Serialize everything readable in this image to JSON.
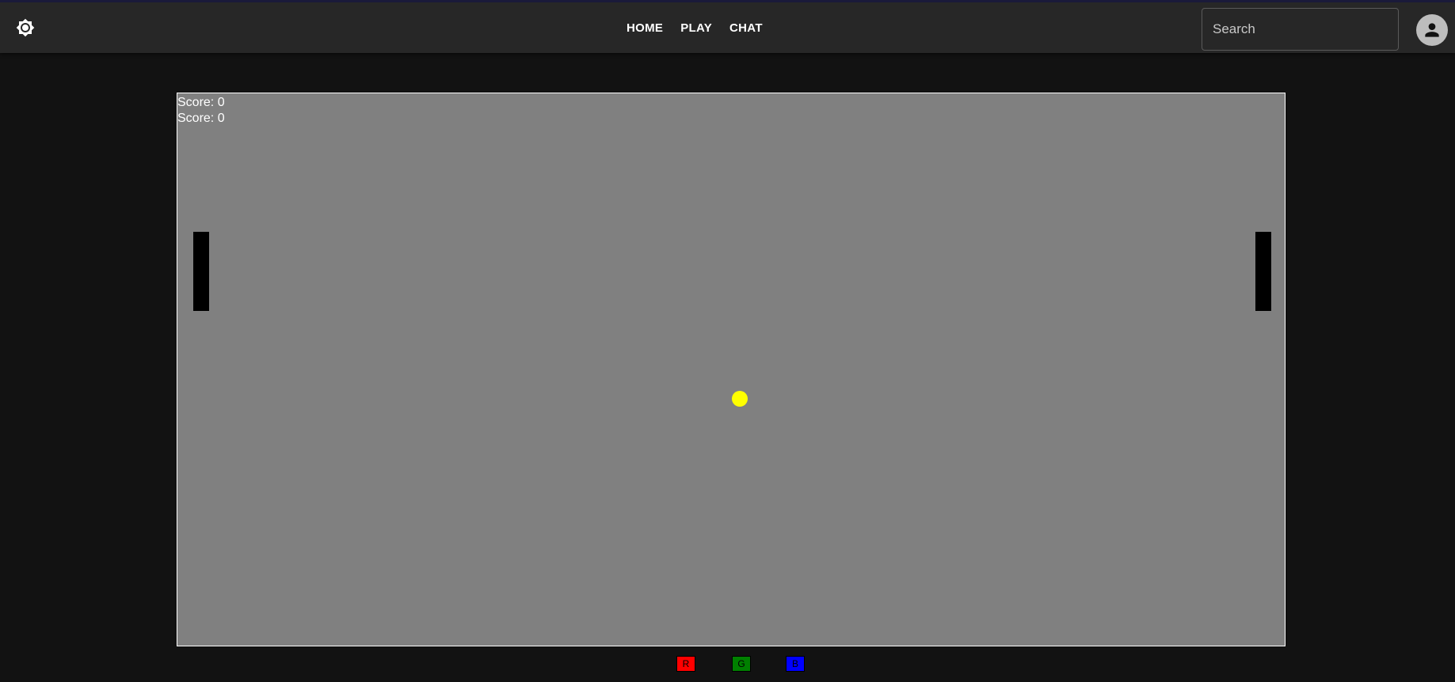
{
  "header": {
    "theme_icon": "brightness-icon",
    "nav": [
      {
        "label": "HOME"
      },
      {
        "label": "PLAY"
      },
      {
        "label": "CHAT"
      }
    ],
    "search": {
      "placeholder": "Search",
      "value": ""
    },
    "avatar_icon": "person-icon"
  },
  "game": {
    "scores": [
      {
        "label": "Score: 0"
      },
      {
        "label": "Score: 0"
      }
    ],
    "colors": {
      "background": "#808080",
      "paddle": "#000000",
      "ball": "#ffff00",
      "border": "#ffffff"
    }
  },
  "color_buttons": [
    {
      "label": "R",
      "color": "#ff0000"
    },
    {
      "label": "G",
      "color": "#008000"
    },
    {
      "label": "B",
      "color": "#0000ff"
    }
  ]
}
